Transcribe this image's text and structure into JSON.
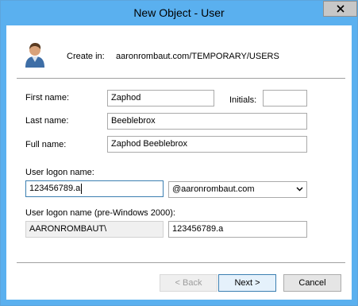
{
  "window": {
    "title": "New Object - User",
    "close_icon": "close-icon"
  },
  "header": {
    "icon": "user-icon",
    "create_in_label": "Create in:",
    "create_in_path": "aaronrombaut.com/TEMPORARY/USERS"
  },
  "form": {
    "first_name_label": "First name:",
    "first_name_value": "Zaphod",
    "initials_label": "Initials:",
    "initials_value": "",
    "last_name_label": "Last name:",
    "last_name_value": "Beeblebrox",
    "full_name_label": "Full name:",
    "full_name_value": "Zaphod Beeblebrox",
    "logon_name_label": "User logon name:",
    "logon_name_value": "123456789.a",
    "upn_suffix_selected": "@aaronrombaut.com",
    "pre2000_label": "User logon name (pre-Windows 2000):",
    "pre2000_domain": "AARONROMBAUT\\",
    "pre2000_value": "123456789.a"
  },
  "buttons": {
    "back": "< Back",
    "next": "Next >",
    "cancel": "Cancel"
  }
}
